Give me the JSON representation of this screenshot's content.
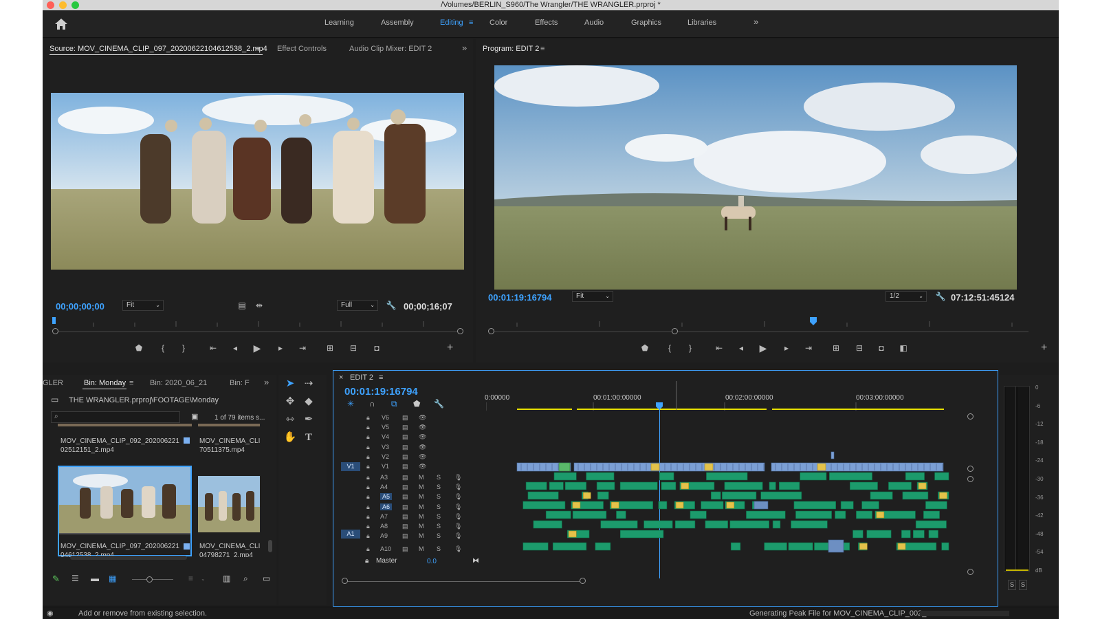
{
  "window": {
    "title": "/Volumes/BERLIN_S960/The Wrangler/THE WRANGLER.prproj *"
  },
  "workspaces": [
    "Learning",
    "Assembly",
    "Editing",
    "Color",
    "Effects",
    "Audio",
    "Graphics",
    "Libraries"
  ],
  "active_workspace": "Editing",
  "source_panel": {
    "tabs": [
      "Source: MOV_CINEMA_CLIP_097_20200622104612538_2.mp4",
      "Effect Controls",
      "Audio Clip Mixer: EDIT 2"
    ],
    "timecode": "00;00;00;00",
    "zoom": "Fit",
    "resolution": "Full",
    "duration": "00;00;16;07"
  },
  "program_panel": {
    "title": "Program: EDIT 2",
    "timecode": "00:01:19:16794",
    "zoom": "Fit",
    "resolution": "1/2",
    "duration": "07:12:51:45124"
  },
  "project_panel": {
    "tabs": [
      "GLER",
      "Bin: Monday",
      "Bin: 2020_06_21",
      "Bin: F"
    ],
    "path": "THE WRANGLER.prproj\\FOOTAGE\\Monday",
    "search_value": "",
    "item_count": "1 of 79 items s...",
    "clips": [
      {
        "name": "MOV_CINEMA_CLIP_092_20200622102512151_2.mp4"
      },
      {
        "name": "MOV_CINEMA_CLIP_...70511375.mp4"
      },
      {
        "name": "MOV_CINEMA_CLIP_097_20200622104612538_2.mp4"
      },
      {
        "name": "MOV_CINEMA_CLIP_...04798271_2.mp4"
      }
    ],
    "clip_text": [
      [
        "MOV_CINEMA_CLIP_092_202006221",
        "02512151_2.mp4"
      ],
      [
        "MOV_CINEMA_CLI",
        "70511375.mp4"
      ],
      [
        "MOV_CINEMA_CLIP_097_202006221",
        "04612538_2.mp4"
      ],
      [
        "MOV_CINEMA_CLI",
        "04798271_2.mp4"
      ]
    ]
  },
  "timeline": {
    "sequence": "EDIT 2",
    "timecode": "00:01:19:16794",
    "ruler": [
      "0:00000",
      "00:01:00:00000",
      "00:02:00:00000",
      "00:03:00:00000"
    ],
    "video_tracks": [
      "V6",
      "V5",
      "V4",
      "V3",
      "V2",
      "V1"
    ],
    "audio_tracks": [
      "A3",
      "A4",
      "A5",
      "A6",
      "A7",
      "A8",
      "A9",
      "A10"
    ],
    "source_patches": {
      "video": "V1",
      "audio": "A1"
    },
    "master": {
      "label": "Master",
      "value": "0.0"
    },
    "mute_label": "M",
    "solo_label": "S"
  },
  "audio_meter": {
    "scale": [
      "0",
      "-6",
      "-12",
      "-18",
      "-24",
      "-30",
      "-36",
      "-42",
      "-48",
      "-54",
      "dB"
    ],
    "solo_buttons": [
      "S",
      "S"
    ]
  },
  "status_bar": {
    "message": "Add or remove from existing selection.",
    "progress_text": "Generating Peak File for MOV_CINEMA_CLIP_002_..."
  },
  "colors": {
    "accent": "#3ea2ff",
    "video_clip": "#7b9fd4",
    "audio_clip": "#1c9b6c",
    "fx_badge": "#e4c24a",
    "work_area": "#e8e000"
  }
}
